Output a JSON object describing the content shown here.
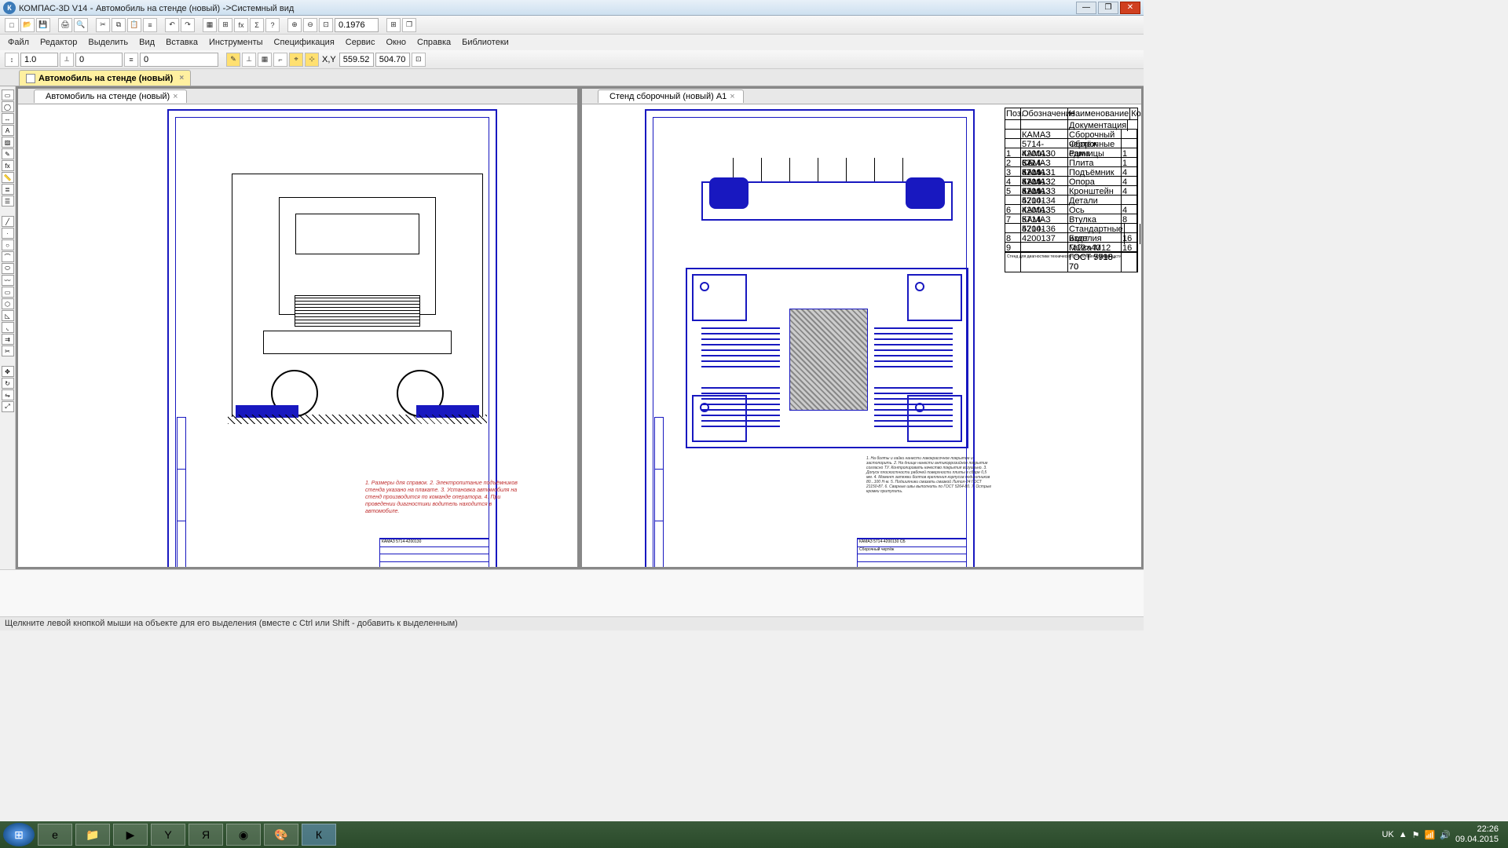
{
  "titlebar": {
    "app": "КОМПАС-3D V14",
    "doc": "Автомобиль на стенде (новый)",
    "view": "Системный вид"
  },
  "menu": {
    "file": "Файл",
    "editor": "Редактор",
    "select": "Выделить",
    "view": "Вид",
    "insert": "Вставка",
    "tools": "Инструменты",
    "spec": "Спецификация",
    "service": "Сервис",
    "window": "Окно",
    "help": "Справка",
    "libs": "Библиотеки"
  },
  "toolbar2": {
    "scale": "1.0",
    "step": "0",
    "layer": "0",
    "zoom": "0.1976",
    "coord_x": "559.52",
    "coord_y": "504.70"
  },
  "tabs": {
    "left": "Автомобиль на стенде (новый)",
    "right": "Стенд сборочный (новый) А1"
  },
  "drawing_left": {
    "brand": "КАМАЗ",
    "code": "КАМАЗ 5714-4200130",
    "notes": "1. Размеры для справок.\n2. Электропитание подъёмников стенда указано на плакате.\n3. Установка автомобиля на стенд производится по команде оператора.\n4. При проведении диагностики водитель находится в автомобиле."
  },
  "drawing_right": {
    "code": "КАМАЗ 5714-4200130 СБ",
    "title": "Сборочный чертёж",
    "notes": "1. На болты и гайки нанести лакокрасочное покрытие и застопорить.\n2. На днище нанести антикоррозийное покрытие согласно ТУ. Контролировать качество покрытия визуально.\n3. Допуск плоскостности рабочей поверхности плиты в сборе 0,5 мм.\n4. Момент затяжки болтов крепления корпусов подшипников 80...100 Н·м.\n5. Подшипники смазать смазкой Литол-24 ГОСТ 21150-87.\n6. Сварные швы выполнить по ГОСТ 5264-80.\n7. Острые кромки притупить."
  },
  "spec": {
    "headers": [
      "Поз.",
      "Обозначение",
      "Наименование",
      "Кол."
    ],
    "rows": [
      [
        "",
        "",
        "Документация",
        ""
      ],
      [
        "",
        "КАМАЗ 5714-4200130 СБ",
        "Сборочный чертёж",
        ""
      ],
      [
        "",
        "",
        "Сборочные единицы",
        ""
      ],
      [
        "1",
        "КАМАЗ 5714-4200131",
        "Рама",
        "1"
      ],
      [
        "2",
        "КАМАЗ 5714-4200132",
        "Плита",
        "1"
      ],
      [
        "3",
        "КАМАЗ 5714-4200133",
        "Подъёмник",
        "4"
      ],
      [
        "4",
        "КАМАЗ 5714-4200134",
        "Опора",
        "4"
      ],
      [
        "5",
        "КАМАЗ 5714-4200135",
        "Кронштейн",
        "4"
      ],
      [
        "",
        "",
        "Детали",
        ""
      ],
      [
        "6",
        "КАМАЗ 5714-4200136",
        "Ось",
        "4"
      ],
      [
        "7",
        "КАМАЗ 5714-4200137",
        "Втулка",
        "8"
      ],
      [
        "",
        "",
        "Стандартные изделия",
        ""
      ],
      [
        "8",
        "",
        "Болт М12×40 ГОСТ 7798-70",
        "16"
      ],
      [
        "9",
        "",
        "Гайка М12 ГОСТ 5915-70",
        "16"
      ]
    ],
    "footer": "Стенд для диагностики технического состояния ходовой части"
  },
  "statusbar": {
    "hint": "Щелкните левой кнопкой мыши на объекте для его выделения (вместе с Ctrl или Shift - добавить к выделенным)"
  },
  "taskbar": {
    "lang": "UK",
    "time": "22:26",
    "date": "09.04.2015"
  }
}
